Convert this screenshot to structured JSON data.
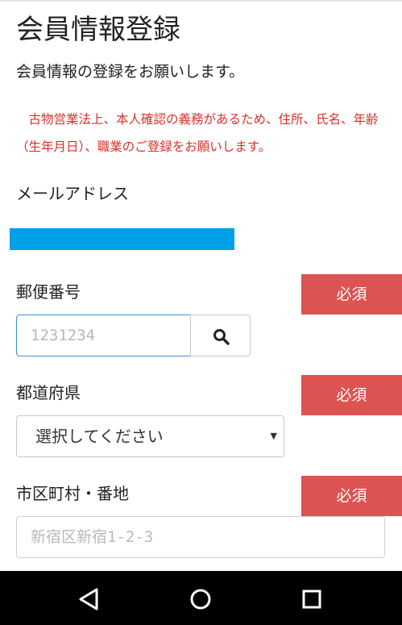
{
  "page": {
    "title": "会員情報登録",
    "lead": "会員情報の登録をお願いします。",
    "notice": "古物営業法上、本人確認の義務があるため、住所、氏名、年齢（生年月日）、職業のご登録をお願いします。"
  },
  "email": {
    "label": "メールアドレス",
    "value_color": "#00a0e8"
  },
  "postal": {
    "label": "郵便番号",
    "required": "必須",
    "placeholder": "1231234",
    "search_icon": "search-icon"
  },
  "prefecture": {
    "label": "都道府県",
    "required": "必須",
    "selected": "選択してください"
  },
  "address": {
    "label": "市区町村・番地",
    "required": "必須",
    "placeholder": "新宿区新宿1-2-3"
  },
  "navigation": {
    "back_icon": "back-icon",
    "home_icon": "home-icon",
    "recents_icon": "recents-icon"
  },
  "colors": {
    "required_badge": "#dc5352",
    "notice_text": "#d9302b",
    "focus_border": "#3d8ed8"
  }
}
